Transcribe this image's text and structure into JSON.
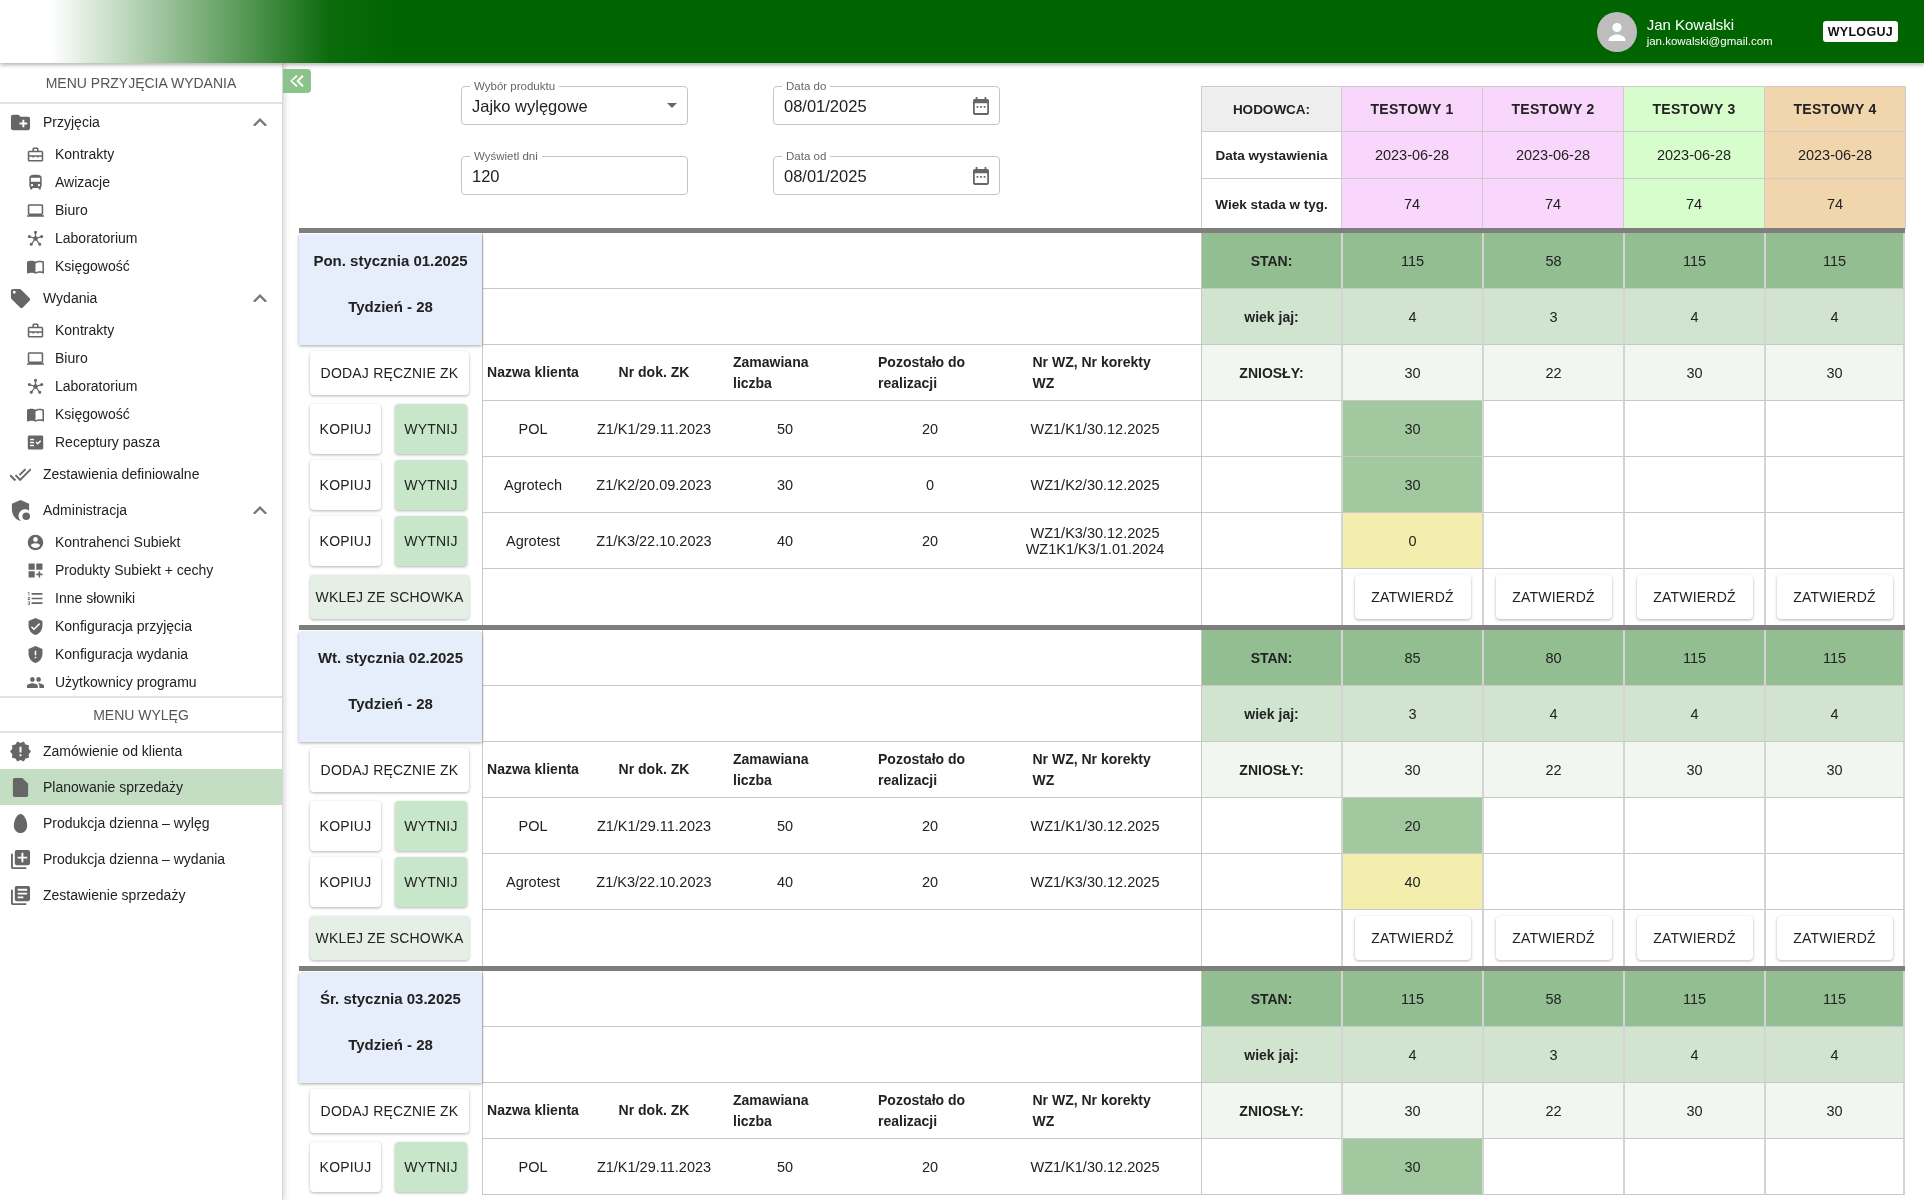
{
  "header": {
    "user_name": "Jan Kowalski",
    "user_email": "jan.kowalski@gmail.com",
    "logout_button": "WYLOGUJ"
  },
  "sidebar": {
    "menus": [
      {
        "title": "MENU PRZYJĘCIA WYDANIA",
        "items": [
          {
            "label": "Przyjęcia",
            "selected": false,
            "expanded": true,
            "children": [
              {
                "label": "Kontrakty",
                "selected": false
              },
              {
                "label": "Awizacje",
                "selected": false
              },
              {
                "label": "Biuro",
                "selected": false
              },
              {
                "label": "Laboratorium",
                "selected": false
              },
              {
                "label": "Księgowość",
                "selected": false
              }
            ]
          },
          {
            "label": "Wydania",
            "selected": false,
            "expanded": true,
            "children": [
              {
                "label": "Kontrakty",
                "selected": false
              },
              {
                "label": "Biuro",
                "selected": false
              },
              {
                "label": "Laboratorium",
                "selected": false
              },
              {
                "label": "Księgowość",
                "selected": false
              },
              {
                "label": "Receptury pasza",
                "selected": false
              }
            ]
          },
          {
            "label": "Zestawienia definiowalne",
            "selected": false
          },
          {
            "label": "Administracja",
            "selected": false,
            "expanded": true,
            "children": [
              {
                "label": "Kontrahenci Subiekt",
                "selected": false
              },
              {
                "label": "Produkty Subiekt + cechy",
                "selected": false
              },
              {
                "label": "Inne słowniki",
                "selected": false
              },
              {
                "label": "Konfiguracja przyjęcia",
                "selected": false
              },
              {
                "label": "Konfiguracja wydania",
                "selected": false
              },
              {
                "label": "Użytkownicy programu",
                "selected": false
              }
            ]
          }
        ]
      },
      {
        "title": "MENU WYLĘG",
        "items": [
          {
            "label": "Zamówienie od klienta",
            "selected": false
          },
          {
            "label": "Planowanie sprzedaży",
            "selected": true
          },
          {
            "label": "Produkcja dzienna – wylęg",
            "selected": false
          },
          {
            "label": "Produkcja dzienna – wydania",
            "selected": false
          },
          {
            "label": "Zestawienie sprzedaży",
            "selected": false
          }
        ]
      }
    ]
  },
  "filters": [
    {
      "kind": "select",
      "label": "Wybór produktu",
      "value": "Jajko wylęgowe"
    },
    {
      "kind": "date",
      "label": "Data do",
      "value": "08/01/2025"
    },
    {
      "kind": "number",
      "label": "Wyświetl dni",
      "value": "120"
    },
    {
      "kind": "date",
      "label": "Data od",
      "value": "08/01/2025"
    }
  ],
  "breeder_table": {
    "header_label": "HODOWCA:",
    "date_label": "Data wystawienia",
    "age_label": "Wiek stada w tyg.",
    "columns": [
      {
        "name": "TESTOWY 1",
        "color": "#f9d6fb",
        "date": "2023-06-28",
        "age": "74"
      },
      {
        "name": "TESTOWY 2",
        "color": "#f9d6fb",
        "date": "2023-06-28",
        "age": "74"
      },
      {
        "name": "TESTOWY 3",
        "color": "#d6fdcb",
        "date": "2023-06-28",
        "age": "74"
      },
      {
        "name": "TESTOWY 4",
        "color": "#f1d5ad",
        "date": "2023-06-28",
        "age": "74"
      }
    ]
  },
  "days": [
    {
      "date": "Pon. stycznia 01.2025",
      "week": "Tydzień - 28",
      "stan_label": "STAN:",
      "stan": [
        "115",
        "58",
        "115",
        "115"
      ],
      "egg_age_label": "wiek jaj:",
      "egg_age": [
        "4",
        "3",
        "4",
        "4"
      ],
      "laid_label": "ZNIOSŁY:",
      "laid": [
        "30",
        "22",
        "30",
        "30"
      ],
      "add_button": "DODAJ RĘCZNIE ZK",
      "order_columns": [
        "Nazwa klienta",
        "Nr dok. ZK",
        "Zamawiana liczba",
        "Pozostało do realizacji",
        "Nr WZ, Nr korekty WZ"
      ],
      "orders": [
        {
          "copy_button": "KOPIUJ",
          "cut_button": "WYTNIJ",
          "client": "POL",
          "zk": "Z1/K1/29.11.2023",
          "ordered": "50",
          "remaining": "20",
          "wz": [
            "WZ1/K1/30.12.2025"
          ],
          "allocations": [
            {
              "value": "30",
              "color": "#a1c89f"
            }
          ]
        },
        {
          "copy_button": "KOPIUJ",
          "cut_button": "WYTNIJ",
          "client": "Agrotech",
          "zk": "Z1/K2/20.09.2023",
          "ordered": "30",
          "remaining": "0",
          "wz": [
            "WZ1/K2/30.12.2025"
          ],
          "allocations": [
            {
              "value": "30",
              "color": "#a1c89f"
            }
          ]
        },
        {
          "copy_button": "KOPIUJ",
          "cut_button": "WYTNIJ",
          "client": "Agrotest",
          "zk": "Z1/K3/22.10.2023",
          "ordered": "40",
          "remaining": "20",
          "wz": [
            "WZ1/K3/30.12.2025",
            "WZ1K1/K3/1.01.2024"
          ],
          "allocations": [
            {
              "value": "0",
              "color": "#f3edae"
            }
          ]
        }
      ],
      "paste_button": "WKLEJ ZE SCHOWKA",
      "confirm_buttons": [
        "ZATWIERDŹ",
        "ZATWIERDŹ",
        "ZATWIERDŹ",
        "ZATWIERDŹ"
      ]
    },
    {
      "date": "Wt. stycznia 02.2025",
      "week": "Tydzień - 28",
      "stan_label": "STAN:",
      "stan": [
        "85",
        "80",
        "115",
        "115"
      ],
      "egg_age_label": "wiek jaj:",
      "egg_age": [
        "3",
        "4",
        "4",
        "4"
      ],
      "laid_label": "ZNIOSŁY:",
      "laid": [
        "30",
        "22",
        "30",
        "30"
      ],
      "add_button": "DODAJ RĘCZNIE ZK",
      "order_columns": [
        "Nazwa klienta",
        "Nr dok. ZK",
        "Zamawiana liczba",
        "Pozostało do realizacji",
        "Nr WZ, Nr korekty WZ"
      ],
      "orders": [
        {
          "copy_button": "KOPIUJ",
          "cut_button": "WYTNIJ",
          "client": "POL",
          "zk": "Z1/K1/29.11.2023",
          "ordered": "50",
          "remaining": "20",
          "wz": [
            "WZ1/K1/30.12.2025"
          ],
          "allocations": [
            {
              "value": "20",
              "color": "#a1c89f"
            }
          ]
        },
        {
          "copy_button": "KOPIUJ",
          "cut_button": "WYTNIJ",
          "client": "Agrotest",
          "zk": "Z1/K3/22.10.2023",
          "ordered": "40",
          "remaining": "20",
          "wz": [
            "WZ1/K3/30.12.2025"
          ],
          "allocations": [
            {
              "value": "40",
              "color": "#f3edae"
            }
          ]
        }
      ],
      "paste_button": "WKLEJ ZE SCHOWKA",
      "confirm_buttons": [
        "ZATWIERDŹ",
        "ZATWIERDŹ",
        "ZATWIERDŹ",
        "ZATWIERDŹ"
      ]
    },
    {
      "date": "Śr. stycznia 03.2025",
      "week": "Tydzień - 28",
      "stan_label": "STAN:",
      "stan": [
        "115",
        "58",
        "115",
        "115"
      ],
      "egg_age_label": "wiek jaj:",
      "egg_age": [
        "4",
        "3",
        "4",
        "4"
      ],
      "laid_label": "ZNIOSŁY:",
      "laid": [
        "30",
        "22",
        "30",
        "30"
      ],
      "add_button": "DODAJ RĘCZNIE ZK",
      "order_columns": [
        "Nazwa klienta",
        "Nr dok. ZK",
        "Zamawiana liczba",
        "Pozostało do realizacji",
        "Nr WZ, Nr korekty WZ"
      ],
      "orders": [
        {
          "copy_button": "KOPIUJ",
          "cut_button": "WYTNIJ",
          "client": "POL",
          "zk": "Z1/K1/29.11.2023",
          "ordered": "50",
          "remaining": "20",
          "wz": [
            "WZ1/K1/30.12.2025"
          ],
          "allocations": [
            {
              "value": "30",
              "color": "#a1c89f"
            }
          ]
        }
      ]
    }
  ]
}
